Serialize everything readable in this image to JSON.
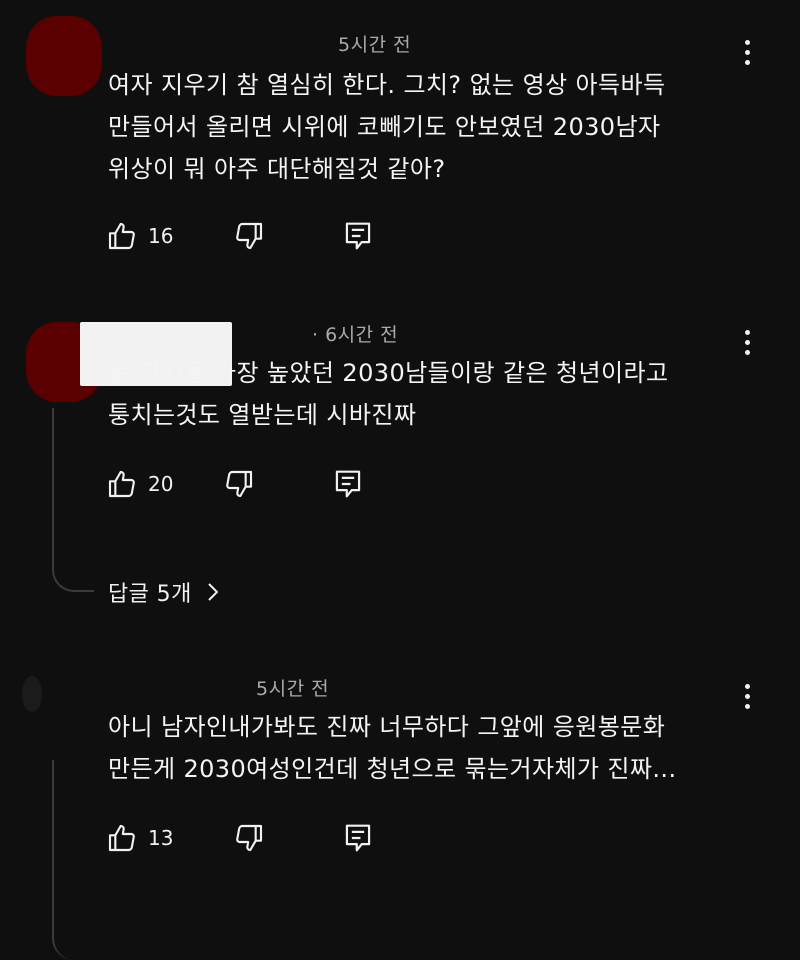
{
  "comments": [
    {
      "time": "5시간 전",
      "lines": [
        "여자 지우기 참 열심히 한다. 그치? 없는 영상 아득바득",
        "만들어서 올리면 시위에 코빼기도 안보였던 2030남자",
        "위상이 뭐 아주 대단해질것 같아?"
      ],
      "likes": "16"
    },
    {
      "time": "· 6시간 전",
      "lines": [
        "윤 지지율 가장 높았던 2030남들이랑 같은 청년이라고",
        "퉁치는것도 열받는데 시바진짜"
      ],
      "likes": "20",
      "replies": "답글 5개"
    },
    {
      "time": "5시간 전",
      "lines": [
        "아니 남자인내가봐도 진짜 너무하다 그앞에 응원봉문화",
        "만든게 2030여성인건데 청년으로 묶는거자체가 진짜..."
      ],
      "likes": "13"
    }
  ],
  "colors": {
    "background": "#0f0f0f",
    "text": "#f1f1f1",
    "meta": "#aaaaaa",
    "avatar_red": "#5a0000"
  },
  "icons": [
    "thumbs-up-icon",
    "thumbs-down-icon",
    "reply-icon",
    "more-vert-icon",
    "chevron-right-icon"
  ]
}
